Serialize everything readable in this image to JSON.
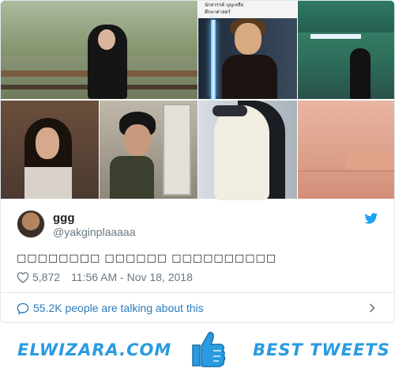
{
  "media": {
    "caption_lines": [
      "นักสวรรค์ บุญเหลือ",
      "ศึกษาศาสตร์"
    ]
  },
  "tweet": {
    "display_name": "ggg",
    "handle": "@yakginplaaaaa",
    "text": "□□□□□□□□ □□□□□□ □□□□□□□□□□",
    "likes": "5,872",
    "timestamp": "11:56 AM - Nov 18, 2018",
    "talking": "55.2K people are talking about this"
  },
  "banner": {
    "left_text": "ELWIZARA.COM",
    "right_text": "BEST TWEETS"
  },
  "colors": {
    "twitter_blue": "#1da1f2",
    "link_blue": "#2b7bb9",
    "muted": "#697882",
    "brand_blue": "#2a9be0"
  },
  "icons": [
    "twitter-bird-icon",
    "heart-icon",
    "speech-bubble-icon",
    "chevron-right-icon",
    "thumbs-up-icon"
  ]
}
